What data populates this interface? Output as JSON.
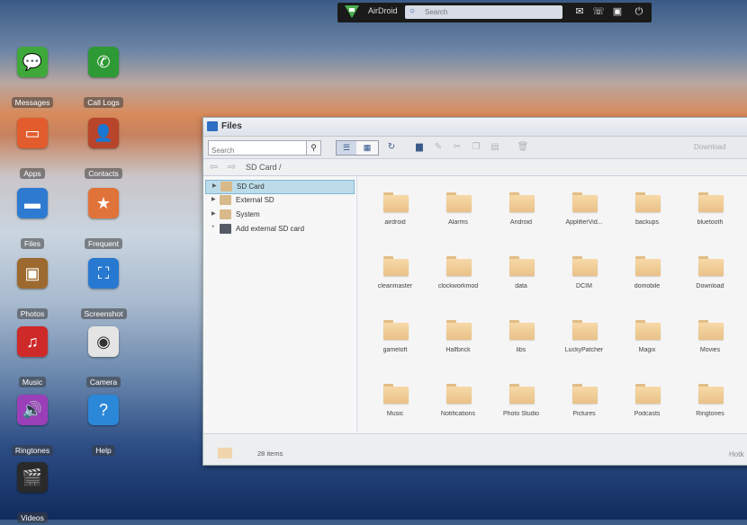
{
  "topbar": {
    "brand": "AirDroid",
    "search_placeholder": "Search"
  },
  "desktop_icons": [
    {
      "label": "Messages",
      "icon": "messages-icon",
      "color": "#3fa83a"
    },
    {
      "label": "Call Logs",
      "icon": "call-logs-icon",
      "color": "#2e9a35"
    },
    {
      "label": "Apps",
      "icon": "apps-icon",
      "color": "#e25c2e"
    },
    {
      "label": "Contacts",
      "icon": "contacts-icon",
      "color": "#b8442a"
    },
    {
      "label": "Files",
      "icon": "files-icon",
      "color": "#2f7ad1"
    },
    {
      "label": "Frequent",
      "icon": "frequent-icon",
      "color": "#e0733a"
    },
    {
      "label": "Photos",
      "icon": "photos-icon",
      "color": "#9c6a2e"
    },
    {
      "label": "Screenshot",
      "icon": "screenshot-icon",
      "color": "#2778d0"
    },
    {
      "label": "Music",
      "icon": "music-icon",
      "color": "#cf2a2a"
    },
    {
      "label": "Camera",
      "icon": "camera-icon",
      "color": "#e4e4e4"
    },
    {
      "label": "Ringtones",
      "icon": "ringtones-icon",
      "color": "#9b3fb8"
    },
    {
      "label": "Help",
      "icon": "help-icon",
      "color": "#2b87d8"
    },
    {
      "label": "Videos",
      "icon": "videos-icon",
      "color": "#2a2a2a"
    }
  ],
  "window": {
    "title": "Files",
    "search_placeholder": "Search",
    "download_label": "Download",
    "breadcrumb": "SD Card /",
    "tree": [
      {
        "label": "SD Card",
        "selected": true
      },
      {
        "label": "External SD",
        "selected": false
      },
      {
        "label": "System",
        "selected": false
      },
      {
        "label": "Add external SD card",
        "selected": false
      }
    ],
    "folders": [
      "airdroid",
      "Alarms",
      "Android",
      "ApplifierVid...",
      "backups",
      "bluetooth",
      "cleanmaster",
      "clockworkmod",
      "data",
      "DCIM",
      "domobile",
      "Download",
      "gameloft",
      "Halfbrick",
      "libs",
      "LuckyPatcher",
      "Magix",
      "Movies",
      "Music",
      "Notifications",
      "Photo Studio",
      "Pictures",
      "Podcasts",
      "Ringtones"
    ],
    "item_count": "28 items",
    "hotkeys_label": "Hotk"
  }
}
